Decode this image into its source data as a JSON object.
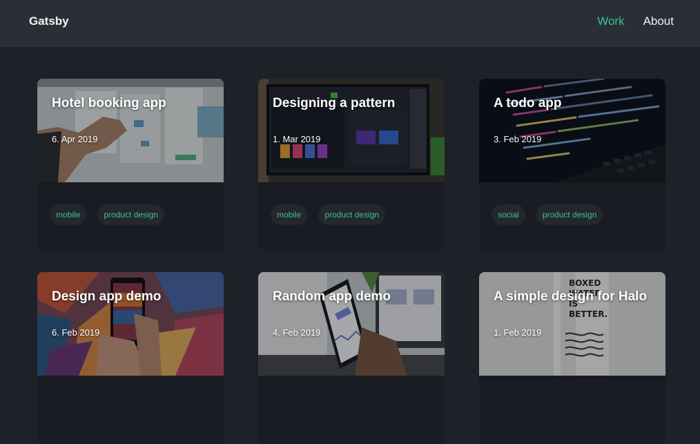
{
  "header": {
    "brand": "Gatsby",
    "nav": [
      {
        "label": "Work",
        "active": true
      },
      {
        "label": "About",
        "active": false
      }
    ]
  },
  "colors": {
    "accent": "#3ec28e",
    "header_bg": "#2a2f37",
    "page_bg": "#1e2128",
    "card_bg": "#191c22"
  },
  "projects": [
    {
      "title": "Hotel booking app",
      "date": "6. Apr 2019",
      "tags": [
        "mobile",
        "product design"
      ],
      "image": "whiteboard-sketch-photo"
    },
    {
      "title": "Designing a pattern",
      "date": "1. Mar 2019",
      "tags": [
        "mobile",
        "product design"
      ],
      "image": "monitor-design-photo"
    },
    {
      "title": "A todo app",
      "date": "3. Feb 2019",
      "tags": [
        "social",
        "product design"
      ],
      "image": "laptop-code-photo"
    },
    {
      "title": "Design app demo",
      "date": "6. Feb 2019",
      "tags": [],
      "image": "phone-graffiti-photo"
    },
    {
      "title": "Random app demo",
      "date": "4. Feb 2019",
      "tags": [],
      "image": "phone-dashboard-photo"
    },
    {
      "title": "A simple design for Halo",
      "date": "1. Feb 2019",
      "tags": [],
      "image": "halo-bottle-photo"
    }
  ]
}
